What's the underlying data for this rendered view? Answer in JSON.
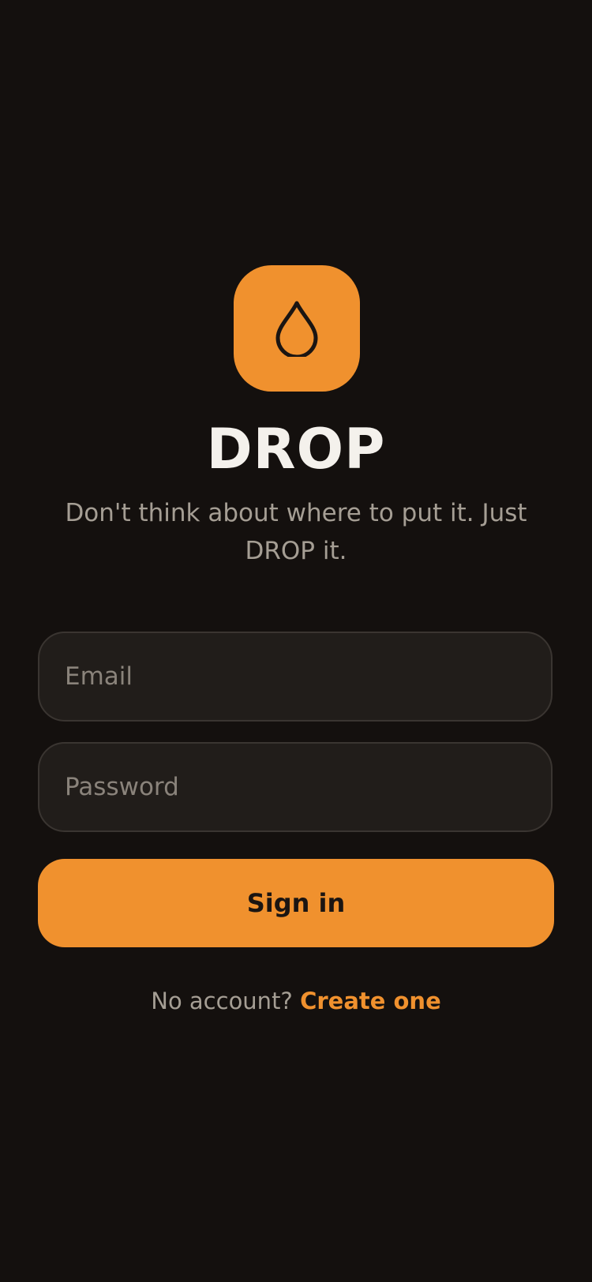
{
  "app": {
    "name": "DROP",
    "tagline": "Don't think about where to put it. Just DROP it.",
    "logo_icon": "drop-icon"
  },
  "form": {
    "email": {
      "value": "",
      "placeholder": "Email"
    },
    "password": {
      "value": "",
      "placeholder": "Password"
    },
    "submit_label": "Sign in"
  },
  "signup": {
    "prompt": "No account?",
    "link_label": "Create one"
  },
  "colors": {
    "background": "#14100e",
    "accent": "#f0912e",
    "field_background": "#211d1a",
    "field_border": "#3a3531",
    "text_primary": "#f4f1ec",
    "text_secondary": "#a59e94"
  }
}
